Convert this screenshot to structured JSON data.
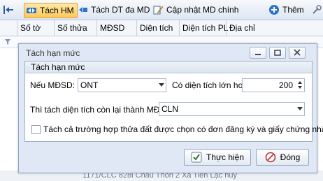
{
  "toolbar": {
    "items": [
      {
        "label": "Tách HM"
      },
      {
        "label": "Tách DT đa MD"
      },
      {
        "label": "Cập nhật MD chính"
      },
      {
        "label": "Thêm"
      }
    ]
  },
  "grid": {
    "columns": [
      "Số tờ",
      "Số thửa",
      "MĐSD",
      "Diện tích",
      "Diện tích PL",
      "Địa chỉ"
    ],
    "bottom_row_text": "1171/CLC   828i Châu Thôn 2 Xã Tiến Lạc huy"
  },
  "dialog": {
    "title": "Tách hạn mức",
    "group_title": "Tách hạn mức",
    "mdsd_label": "Nếu MĐSD:",
    "mdsd_value": "ONT",
    "area_label": "Có diện tích lớn hơn",
    "area_value": "200",
    "remain_label": "Thì tách diện tích còn lại thành MĐSD:",
    "remain_value": "CLN",
    "checkbox_label": "Tách cả trường hợp thửa đất được chọn có đơn đăng ký và giấy chứng nhận",
    "checkbox_checked": false,
    "ok_label": "Thực hiện",
    "close_label": "Đóng"
  },
  "colors": {
    "accent": "#ffc95a",
    "dialog_bg": "#dfe8f4",
    "border": "#8fa6c4"
  }
}
